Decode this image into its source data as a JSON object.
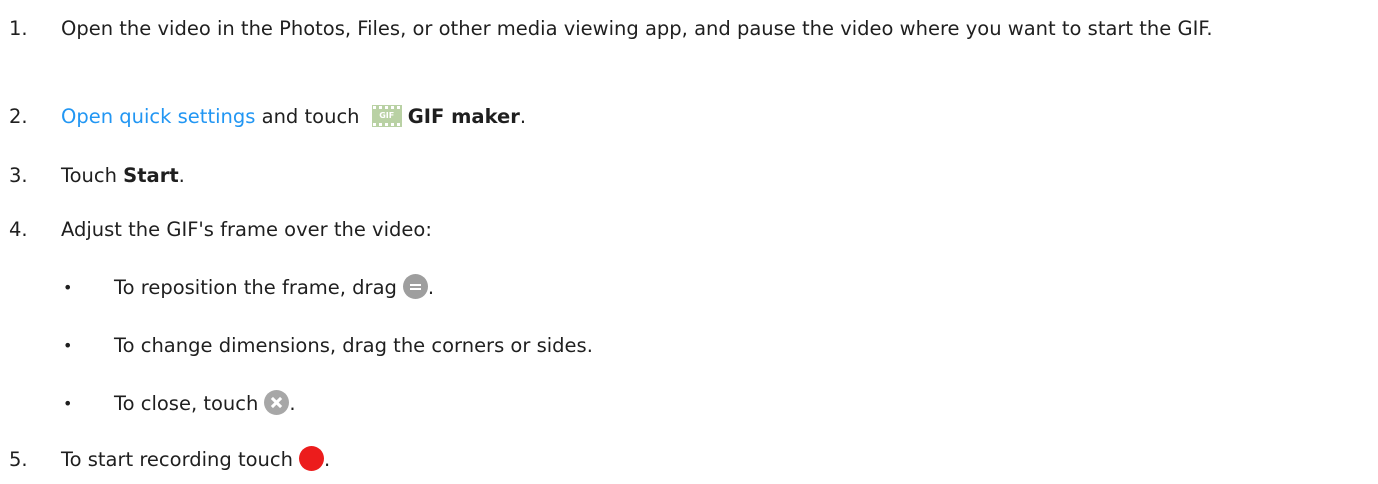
{
  "steps": [
    {
      "num": "1.",
      "text": "Open the video in the Photos, Files, or other media viewing app, and pause the video where you want to start the GIF."
    },
    {
      "num": "2.",
      "link": "Open quick settings",
      "mid": " and touch ",
      "icon": "gif-maker-icon",
      "icon_text": "GIF",
      "bold": "GIF maker",
      "end": "."
    },
    {
      "num": "3.",
      "pre": "Touch ",
      "bold": "Start",
      "end": "."
    },
    {
      "num": "4.",
      "text": "Adjust the GIF's frame over the video:",
      "subitems": [
        {
          "bullet": "•",
          "text": "To reposition the frame, drag",
          "icon": "drag-handle-icon",
          "end": "."
        },
        {
          "bullet": "•",
          "text": "To change dimensions, drag the corners or sides."
        },
        {
          "bullet": "•",
          "text": "To close, touch",
          "icon": "close-icon",
          "end": "."
        }
      ]
    },
    {
      "num": "5.",
      "text": "To start recording touch",
      "icon": "record-icon",
      "end": "."
    }
  ],
  "colors": {
    "text": "#1f1f1f",
    "link": "#2196f3",
    "record": "#ec1c1c",
    "gray_icon": "#9e9e9e",
    "gif_icon": "#b9d1a4"
  }
}
